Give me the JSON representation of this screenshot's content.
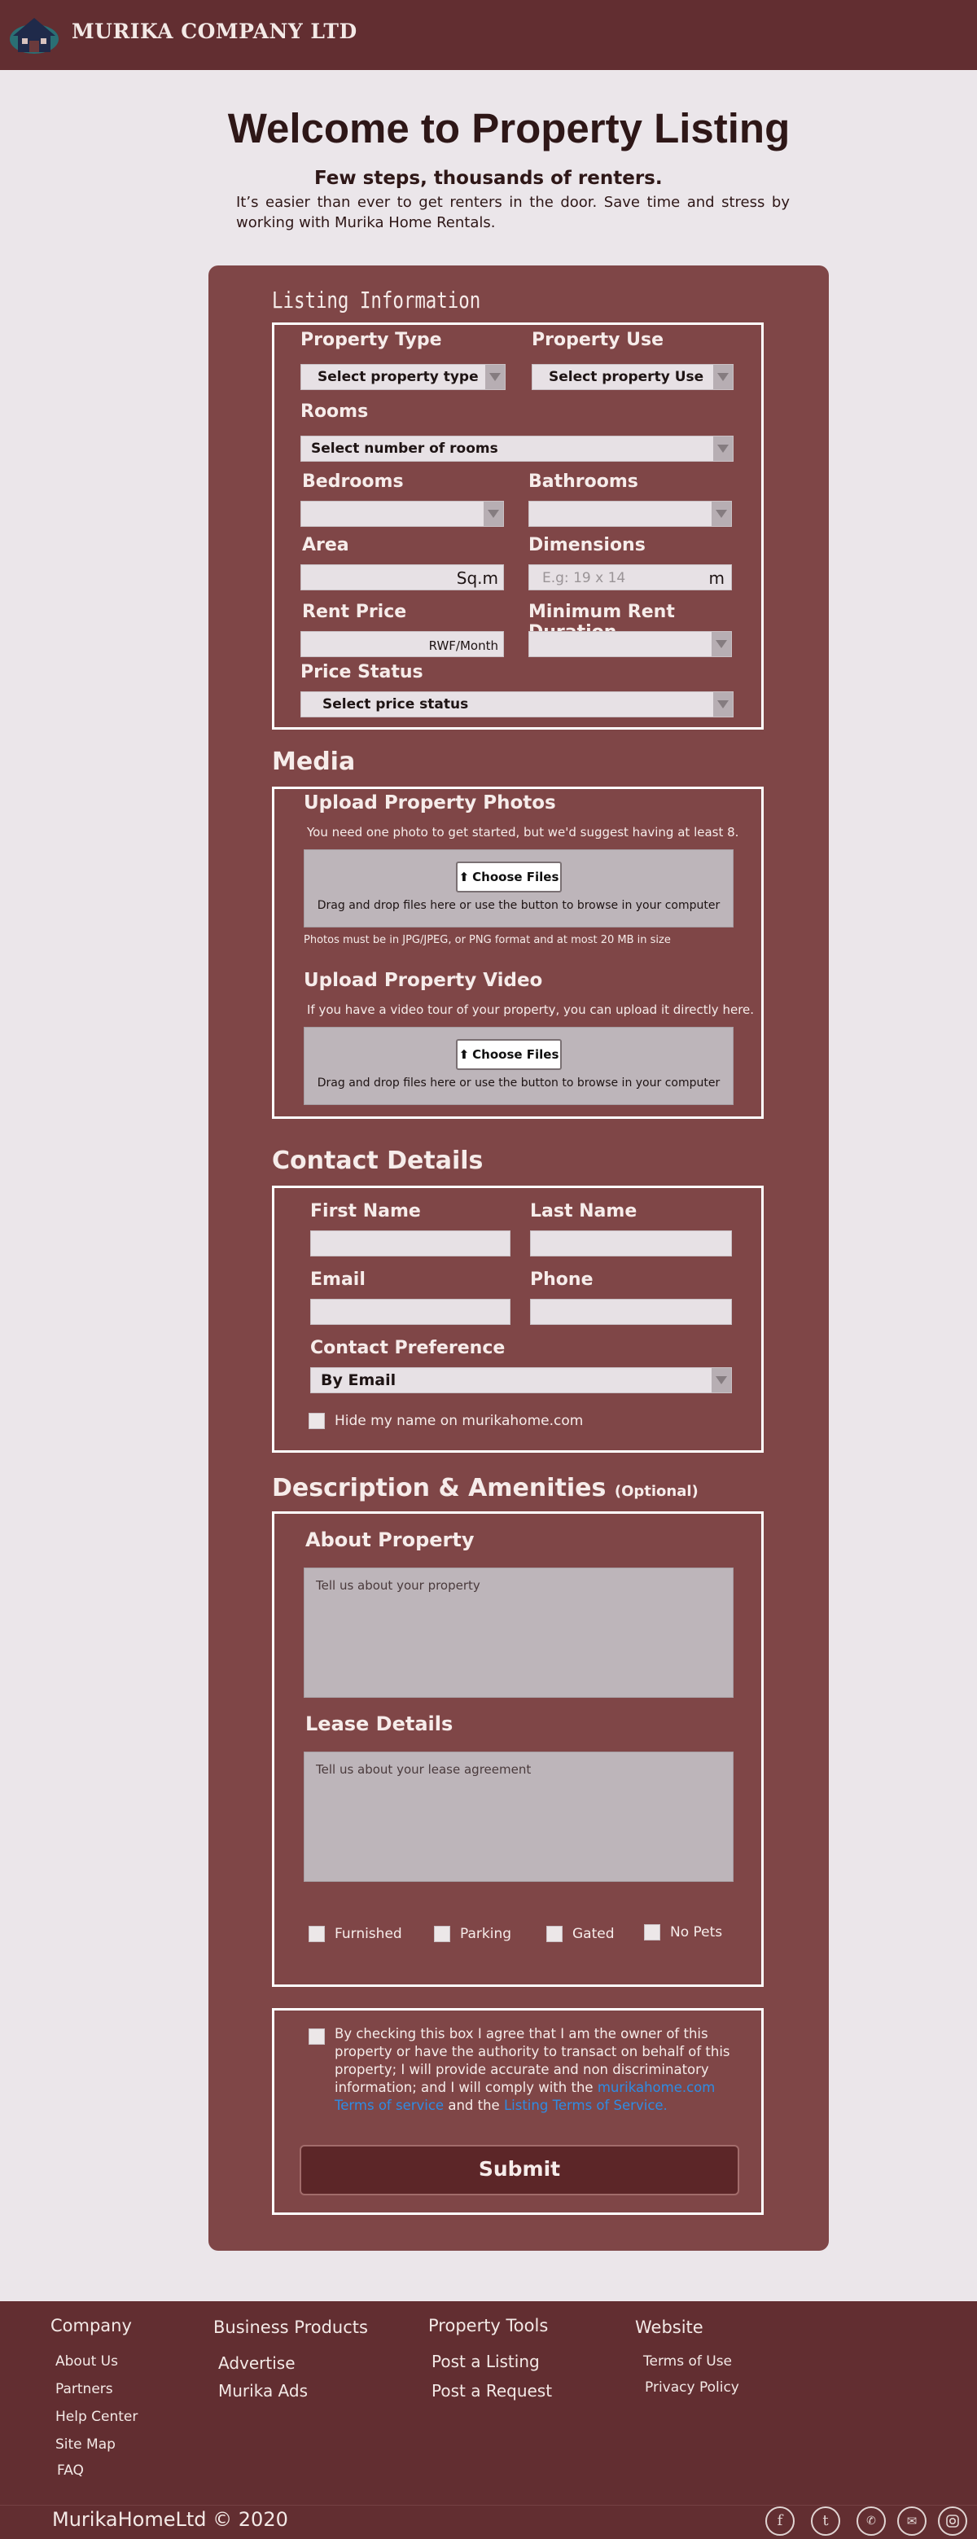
{
  "brand": {
    "name": "MURIKA COMPANY LTD",
    "logo": "house-logo"
  },
  "hero": {
    "title": "Welcome to Property Listing",
    "subtitle": "Few steps, thousands of renters.",
    "description": "It’s easier than ever to get renters in the door. Save time and stress by working with Murika Home Rentals."
  },
  "listing": {
    "heading": "Listing Information",
    "property_type_label": "Property Type",
    "property_type_value": "Select property type",
    "property_use_label": "Property Use",
    "property_use_value": "Select property Use",
    "rooms_label": "Rooms",
    "rooms_value": "Select number of rooms",
    "bedrooms_label": "Bedrooms",
    "bathrooms_label": "Bathrooms",
    "area_label": "Area",
    "area_unit": "Sq.m",
    "dimensions_label": "Dimensions",
    "dimensions_placeholder": "E.g: 19 x 14",
    "dimensions_unit": "m",
    "rent_price_label": "Rent Price",
    "rent_price_unit": "RWF/Month",
    "min_rent_label": "Minimum Rent Duration",
    "price_status_label": "Price Status",
    "price_status_value": "Select price status"
  },
  "media": {
    "heading": "Media",
    "photos_title": "Upload Property Photos",
    "photos_note": "You need one photo to get started, but we'd suggest having at least 8.",
    "choose_label": "Choose Files",
    "drop_text": "Drag and drop files here or use the button to browse in your computer",
    "photos_rule": "Photos must be in JPG/JPEG, or PNG format and at most 20 MB in size",
    "video_title": "Upload Property Video",
    "video_note": "If you have a video tour of your property, you can upload it directly here."
  },
  "contact": {
    "heading": "Contact Details",
    "first_name_label": "First Name",
    "last_name_label": "Last Name",
    "email_label": "Email",
    "phone_label": "Phone",
    "preference_label": "Contact Preference",
    "preference_value": "By Email",
    "hide_name_label": "Hide my name on murikahome.com"
  },
  "description": {
    "heading": "Description & Amenities",
    "optional": "(Optional)",
    "about_title": "About Property",
    "about_placeholder": "Tell us about your property",
    "lease_title": "Lease Details",
    "lease_placeholder": "Tell us about your lease agreement",
    "amenities": [
      "Furnished",
      "Parking",
      "Gated",
      "No Pets"
    ]
  },
  "agreement": {
    "text": "By checking this box I agree that I am the owner of this property or have the authority to transact on behalf of this property; I will provide accurate and non discriminatory information; and I will comply with the",
    "link1": "murikahome.com Terms of service",
    "and": "and the",
    "link2": "Listing Terms of Service."
  },
  "submit_label": "Submit",
  "footer": {
    "company": {
      "heading": "Company",
      "items": [
        "About Us",
        "Partners",
        "Help Center",
        "Site Map",
        "FAQ"
      ]
    },
    "business": {
      "heading": "Business Products",
      "items": [
        "Advertise",
        "Murika Ads"
      ]
    },
    "tools": {
      "heading": "Property Tools",
      "items": [
        "Post a Listing",
        "Post a Request"
      ]
    },
    "website": {
      "heading": "Website",
      "items": [
        "Terms of Use",
        "Privacy Policy"
      ]
    },
    "copyright": "MurikaHomeLtd © 2020",
    "social": [
      "facebook-icon",
      "tumblr-icon",
      "whatsapp-icon",
      "email-icon",
      "instagram-icon"
    ]
  },
  "colors": {
    "header_bg": "#622e31",
    "card_bg": "#7f4647",
    "page_bg": "#ebe6ea",
    "link": "#2e8ce4"
  }
}
